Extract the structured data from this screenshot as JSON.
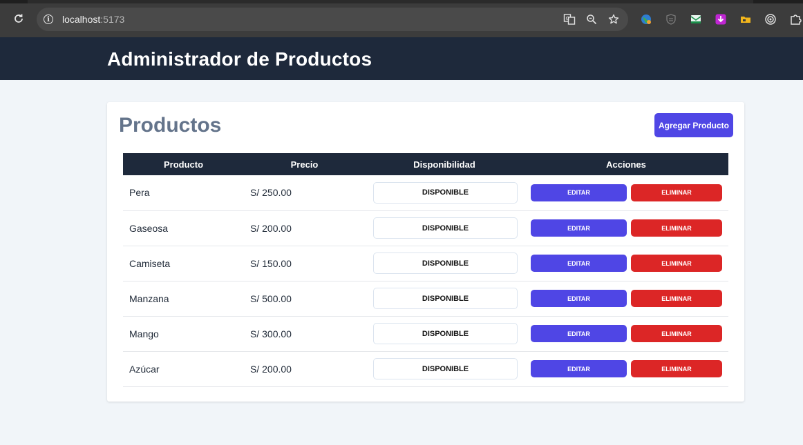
{
  "browser": {
    "url_host": "localhost",
    "url_port": ":5173",
    "icons": [
      "reload-icon",
      "info-icon",
      "translate-icon",
      "zoom-icon",
      "star-icon"
    ],
    "extensions": [
      "globe-extension-icon",
      "shield-extension-icon",
      "mail-extension-icon",
      "download-extension-icon",
      "folder-extension-icon",
      "target-extension-icon",
      "puzzle-extension-icon"
    ]
  },
  "header": {
    "title": "Administrador de Productos"
  },
  "card": {
    "title": "Productos",
    "add_button": "Agregar Producto"
  },
  "table": {
    "headers": {
      "product": "Producto",
      "price": "Precio",
      "availability": "Disponibilidad",
      "actions": "Acciones"
    },
    "rows": [
      {
        "name": "Pera",
        "price": "S/ 250.00",
        "availability": "DISPONIBLE",
        "edit": "EDITAR",
        "delete": "ELIMINAR"
      },
      {
        "name": "Gaseosa",
        "price": "S/ 200.00",
        "availability": "DISPONIBLE",
        "edit": "EDITAR",
        "delete": "ELIMINAR"
      },
      {
        "name": "Camiseta",
        "price": "S/ 150.00",
        "availability": "DISPONIBLE",
        "edit": "EDITAR",
        "delete": "ELIMINAR"
      },
      {
        "name": "Manzana",
        "price": "S/ 500.00",
        "availability": "DISPONIBLE",
        "edit": "EDITAR",
        "delete": "ELIMINAR"
      },
      {
        "name": "Mango",
        "price": "S/ 300.00",
        "availability": "DISPONIBLE",
        "edit": "EDITAR",
        "delete": "ELIMINAR"
      },
      {
        "name": "Azúcar",
        "price": "S/ 200.00",
        "availability": "DISPONIBLE",
        "edit": "EDITAR",
        "delete": "ELIMINAR"
      }
    ]
  },
  "colors": {
    "header_bg": "#1e293b",
    "primary": "#4f46e5",
    "danger": "#dc2626",
    "page_bg": "#f1f5f9"
  }
}
